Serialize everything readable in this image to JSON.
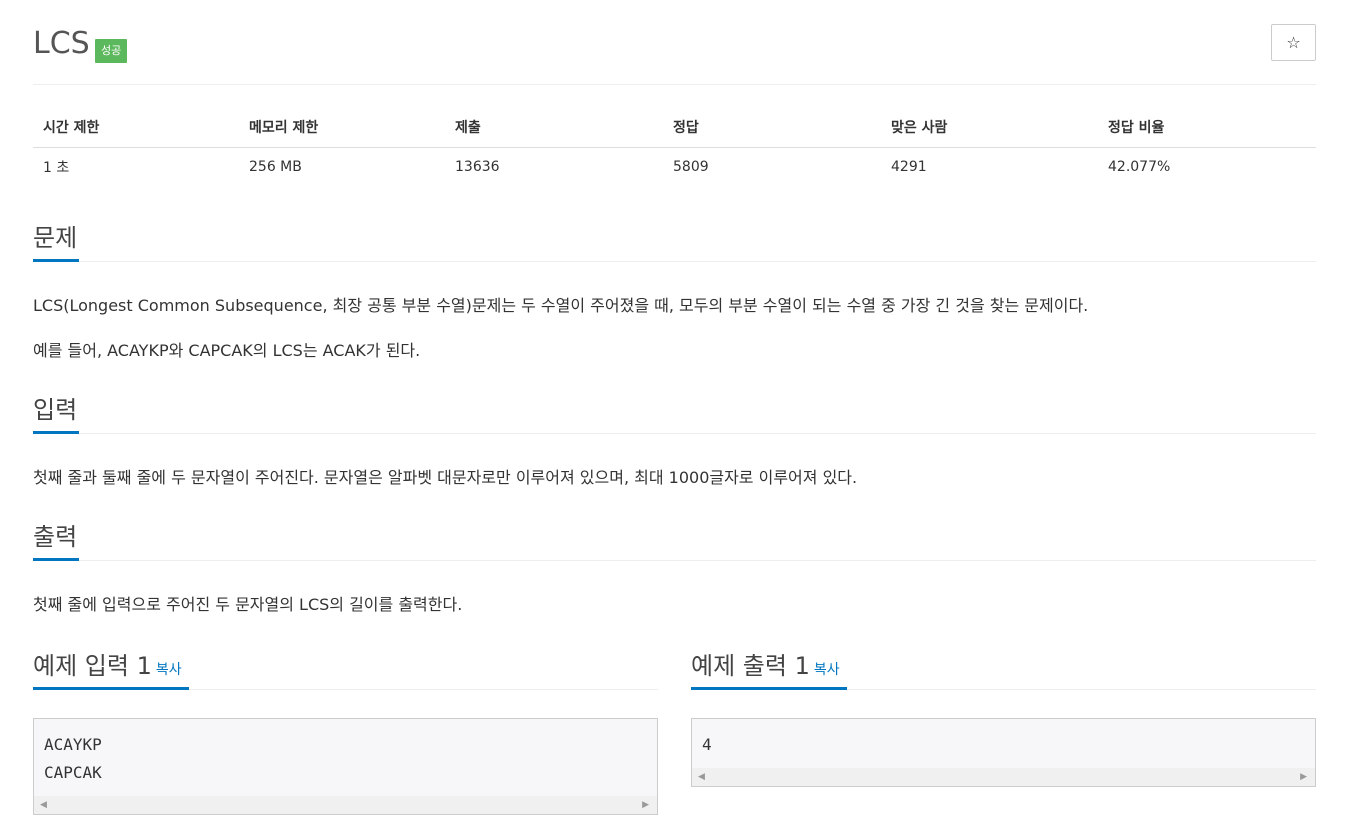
{
  "header": {
    "title": "LCS",
    "badge": "성공",
    "star_icon": "☆"
  },
  "info": {
    "headers": [
      "시간 제한",
      "메모리 제한",
      "제출",
      "정답",
      "맞은 사람",
      "정답 비율"
    ],
    "values": [
      "1 초",
      "256 MB",
      "13636",
      "5809",
      "4291",
      "42.077%"
    ]
  },
  "problem": {
    "heading": "문제",
    "paragraphs": [
      "LCS(Longest Common Subsequence, 최장 공통 부분 수열)문제는 두 수열이 주어졌을 때, 모두의 부분 수열이 되는 수열 중 가장 긴 것을 찾는 문제이다.",
      "예를 들어, ACAYKP와 CAPCAK의 LCS는 ACAK가 된다."
    ]
  },
  "input": {
    "heading": "입력",
    "paragraph": "첫째 줄과 둘째 줄에 두 문자열이 주어진다. 문자열은 알파벳 대문자로만 이루어져 있으며, 최대 1000글자로 이루어져 있다."
  },
  "output": {
    "heading": "출력",
    "paragraph": "첫째 줄에 입력으로 주어진 두 문자열의 LCS의 길이를 출력한다."
  },
  "sample_input": {
    "heading": "예제 입력 1",
    "copy_label": "복사",
    "lines": [
      "ACAYKP",
      "CAPCAK"
    ]
  },
  "sample_output": {
    "heading": "예제 출력 1",
    "copy_label": "복사",
    "lines": [
      "4"
    ]
  },
  "scroll_arrows": {
    "left": "◀",
    "right": "▶"
  }
}
